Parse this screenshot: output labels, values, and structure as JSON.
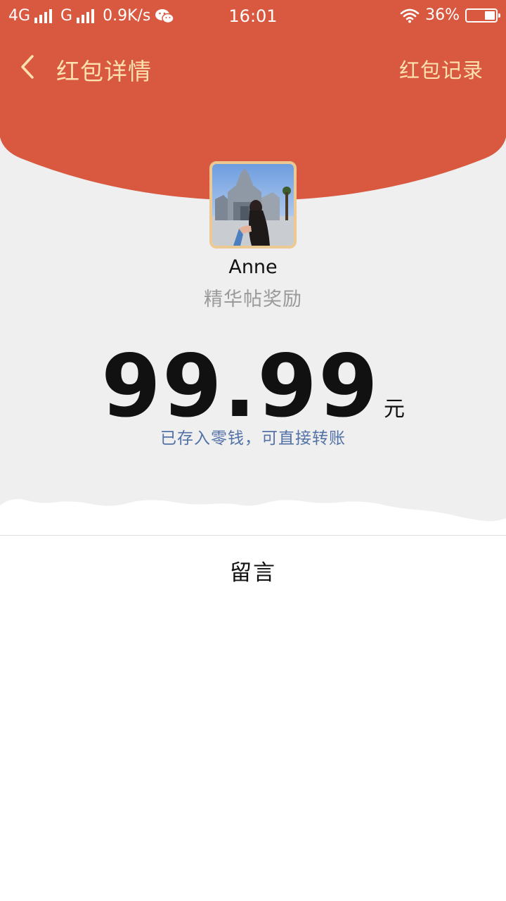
{
  "status_bar": {
    "network1": "4G",
    "network2": "G",
    "speed": "0.9K/s",
    "time": "16:01",
    "battery": "36%",
    "battery_level": 0.36
  },
  "header": {
    "title": "红包详情",
    "right_link": "红包记录",
    "color": "#d95940",
    "accent_text_color": "#fde2b0"
  },
  "sender": {
    "name": "Anne",
    "subtitle": "精华帖奖励"
  },
  "amount": {
    "value": "99.99",
    "unit": "元",
    "note": "已存入零钱，可直接转账"
  },
  "message": {
    "label": "留言"
  }
}
